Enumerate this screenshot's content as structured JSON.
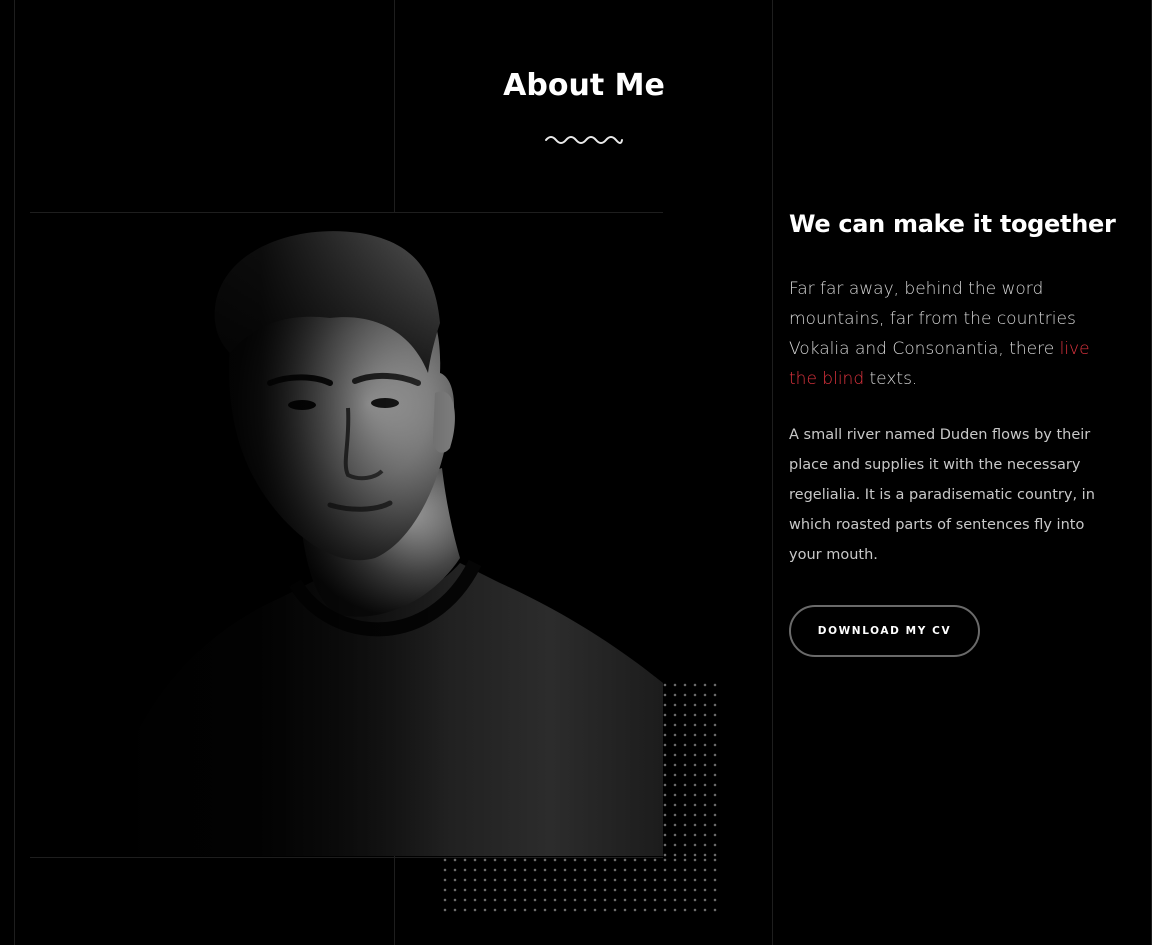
{
  "section": {
    "title": "About Me"
  },
  "about": {
    "heading": "We can make it together",
    "lead_text_before": "Far far away, behind the word mountains, far from the countries Vokalia and Consonantia, there ",
    "lead_text_link": "live the blind",
    "lead_text_after": " texts.",
    "body_text": "A small river named Duden flows by their place and supplies it with the necessary regelialia. It is a paradisematic country, in which roasted parts of sentences fly into your mouth.",
    "button_label": "DOWNLOAD MY CV"
  },
  "colors": {
    "background": "#000000",
    "accent": "#e0343f",
    "text_primary": "#ffffff",
    "text_secondary": "#c8c8c8",
    "grid_line": "#1e1e1e"
  },
  "icons": {
    "divider": "wave-divider-icon",
    "decoration": "dot-grid-pattern"
  }
}
